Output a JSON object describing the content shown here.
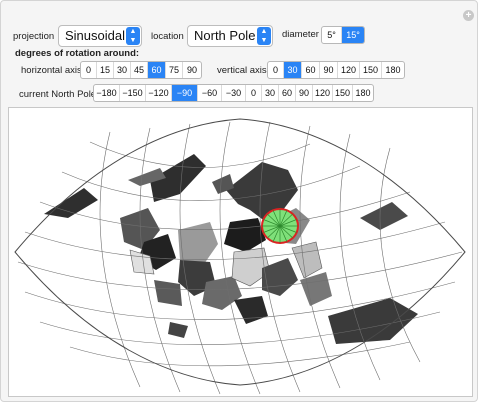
{
  "controls": {
    "projection_label": "projection",
    "projection_value": "Sinusoidal",
    "location_label": "location",
    "location_value": "North Pole",
    "diameter_label": "diameter",
    "diameter_options": [
      "5°",
      "15°"
    ],
    "diameter_selected": "15°",
    "rotation_heading": "degrees of rotation around:",
    "horizontal_label": "horizontal axis",
    "horizontal_options": [
      "0",
      "15",
      "30",
      "45",
      "60",
      "75",
      "90"
    ],
    "horizontal_selected": "60",
    "vertical_label": "vertical axis",
    "vertical_options": [
      "0",
      "30",
      "60",
      "90",
      "120",
      "150",
      "180"
    ],
    "vertical_selected": "30",
    "northpole_label": "current North Pole",
    "northpole_options": [
      "−180",
      "−150",
      "−120",
      "−90",
      "−60",
      "−30",
      "0",
      "30",
      "60",
      "90",
      "120",
      "150",
      "180"
    ],
    "northpole_selected": "−90"
  },
  "icons": {
    "plus": "plus-circle-icon",
    "dropdown": "chevron-updown-icon"
  },
  "colors": {
    "accent": "#2a84f5",
    "circle_fill": "#7fe07a",
    "circle_stroke": "#dd2222"
  }
}
